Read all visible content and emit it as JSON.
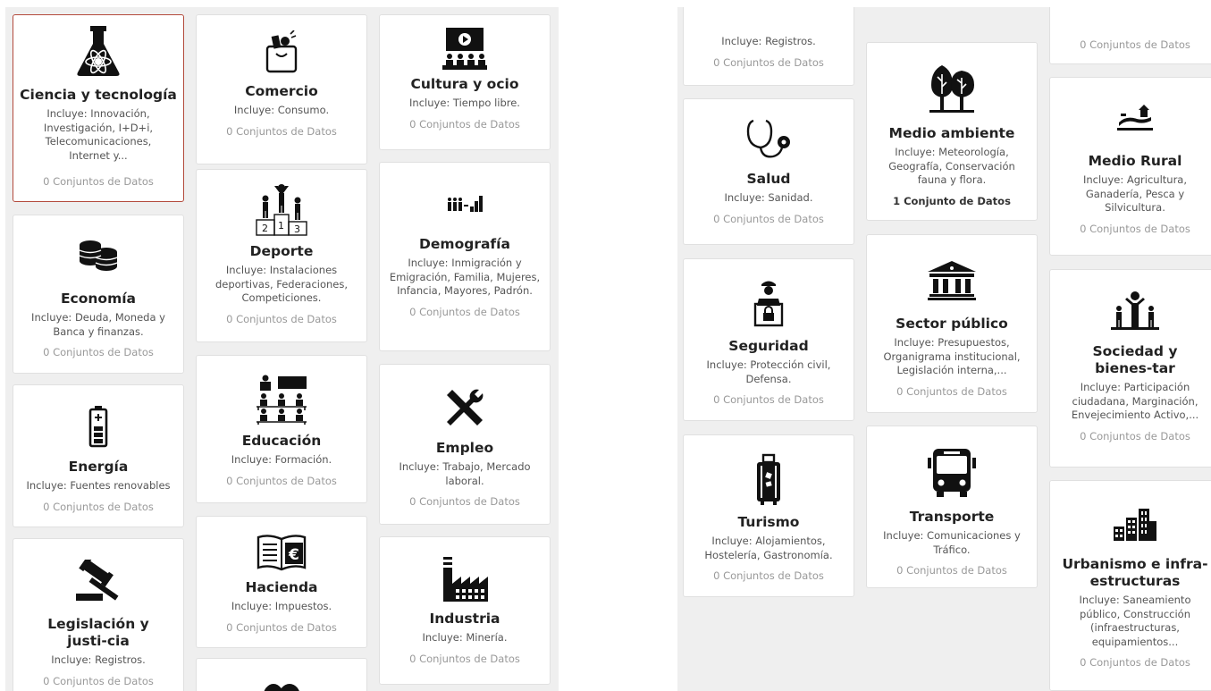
{
  "count_zero": "0 Conjuntos de Datos",
  "left": {
    "ciencia": {
      "title": "Ciencia y tecnología",
      "desc": "Incluye: Innovación, Investigación, I+D+i, Telecomunicaciones, Internet y...",
      "count": "0 Conjuntos de Datos",
      "icon": "flask-icon"
    },
    "economia": {
      "title": "Economía",
      "desc": "Incluye: Deuda, Moneda y Banca y finanzas.",
      "count": "0 Conjuntos de Datos",
      "icon": "coins-icon"
    },
    "energia": {
      "title": "Energía",
      "desc": "Incluye: Fuentes renovables",
      "count": "0 Conjuntos de Datos",
      "icon": "battery-icon"
    },
    "legislacion": {
      "title": "Legislación y justi-cia",
      "desc": "Incluye: Registros.",
      "count": "0 Conjuntos de Datos",
      "icon": "gavel-icon"
    },
    "comercio": {
      "title": "Comercio",
      "desc": "Incluye: Consumo.",
      "count": "0 Conjuntos de Datos",
      "icon": "shopping-bag-icon"
    },
    "deporte": {
      "title": "Deporte",
      "desc": "Incluye: Instalaciones deportivas, Federaciones, Competiciones.",
      "count": "0 Conjuntos de Datos",
      "icon": "podium-icon"
    },
    "educacion": {
      "title": "Educación",
      "desc": "Incluye: Formación.",
      "count": "0 Conjuntos de Datos",
      "icon": "classroom-icon"
    },
    "hacienda": {
      "title": "Hacienda",
      "desc": "Incluye: Impuestos.",
      "count": "0 Conjuntos de Datos",
      "icon": "euro-book-icon"
    },
    "cultura": {
      "title": "Cultura y ocio",
      "desc": "Incluye: Tiempo libre.",
      "count": "0 Conjuntos de Datos",
      "icon": "cinema-icon"
    },
    "demografia": {
      "title": "Demografía",
      "desc": "Incluye: Inmigración y Emigración, Familia, Mujeres, Infancia, Mayores, Padrón.",
      "count": "0 Conjuntos de Datos",
      "icon": "population-chart-icon"
    },
    "empleo": {
      "title": "Empleo",
      "desc": "Incluye: Trabajo, Mercado laboral.",
      "count": "0 Conjuntos de Datos",
      "icon": "tools-icon"
    },
    "industria": {
      "title": "Industria",
      "desc": "Incluye: Minería.",
      "count": "0 Conjuntos de Datos",
      "icon": "factory-icon"
    }
  },
  "right": {
    "legislacion_partial": {
      "desc": "Incluye: Registros.",
      "count": "0 Conjuntos de Datos"
    },
    "salud": {
      "title": "Salud",
      "desc": "Incluye: Sanidad.",
      "count": "0 Conjuntos de Datos",
      "icon": "stethoscope-icon"
    },
    "seguridad": {
      "title": "Seguridad",
      "desc": "Incluye: Protección civil, Defensa.",
      "count": "0 Conjuntos de Datos",
      "icon": "security-guard-icon"
    },
    "turismo": {
      "title": "Turismo",
      "desc": "Incluye: Alojamientos, Hostelería, Gastronomía.",
      "count": "0 Conjuntos de Datos",
      "icon": "suitcase-icon"
    },
    "medio_ambiente": {
      "title": "Medio ambiente",
      "desc": "Incluye: Meteorología, Geografía, Conservación fauna y flora.",
      "count": "1 Conjunto de Datos",
      "icon": "trees-icon"
    },
    "sector_publico": {
      "title": "Sector público",
      "desc": "Incluye: Presupuestos, Organigrama institucional, Legislación interna,...",
      "count": "0 Conjuntos de Datos",
      "icon": "government-building-icon"
    },
    "transporte": {
      "title": "Transporte",
      "desc": "Incluye: Comunicaciones y Tráfico.",
      "count": "0 Conjuntos de Datos",
      "icon": "bus-icon"
    },
    "partial_top": {
      "count": "0 Conjuntos de Datos"
    },
    "medio_rural": {
      "title": "Medio Rural",
      "desc": "Incluye: Agricultura, Ganadería, Pesca y Silvicultura.",
      "count": "0 Conjuntos de Datos",
      "icon": "farm-icon"
    },
    "sociedad": {
      "title": "Sociedad y bienes-tar",
      "desc": "Incluye: Participación ciudadana, Marginación, Envejecimiento Activo,...",
      "count": "0 Conjuntos de Datos",
      "icon": "family-icon"
    },
    "urbanismo": {
      "title": "Urbanismo e infra-estructuras",
      "desc": "Incluye: Saneamiento público, Construcción (infraestructuras, equipamientos...",
      "count": "0 Conjuntos de Datos",
      "icon": "city-buildings-icon"
    }
  }
}
